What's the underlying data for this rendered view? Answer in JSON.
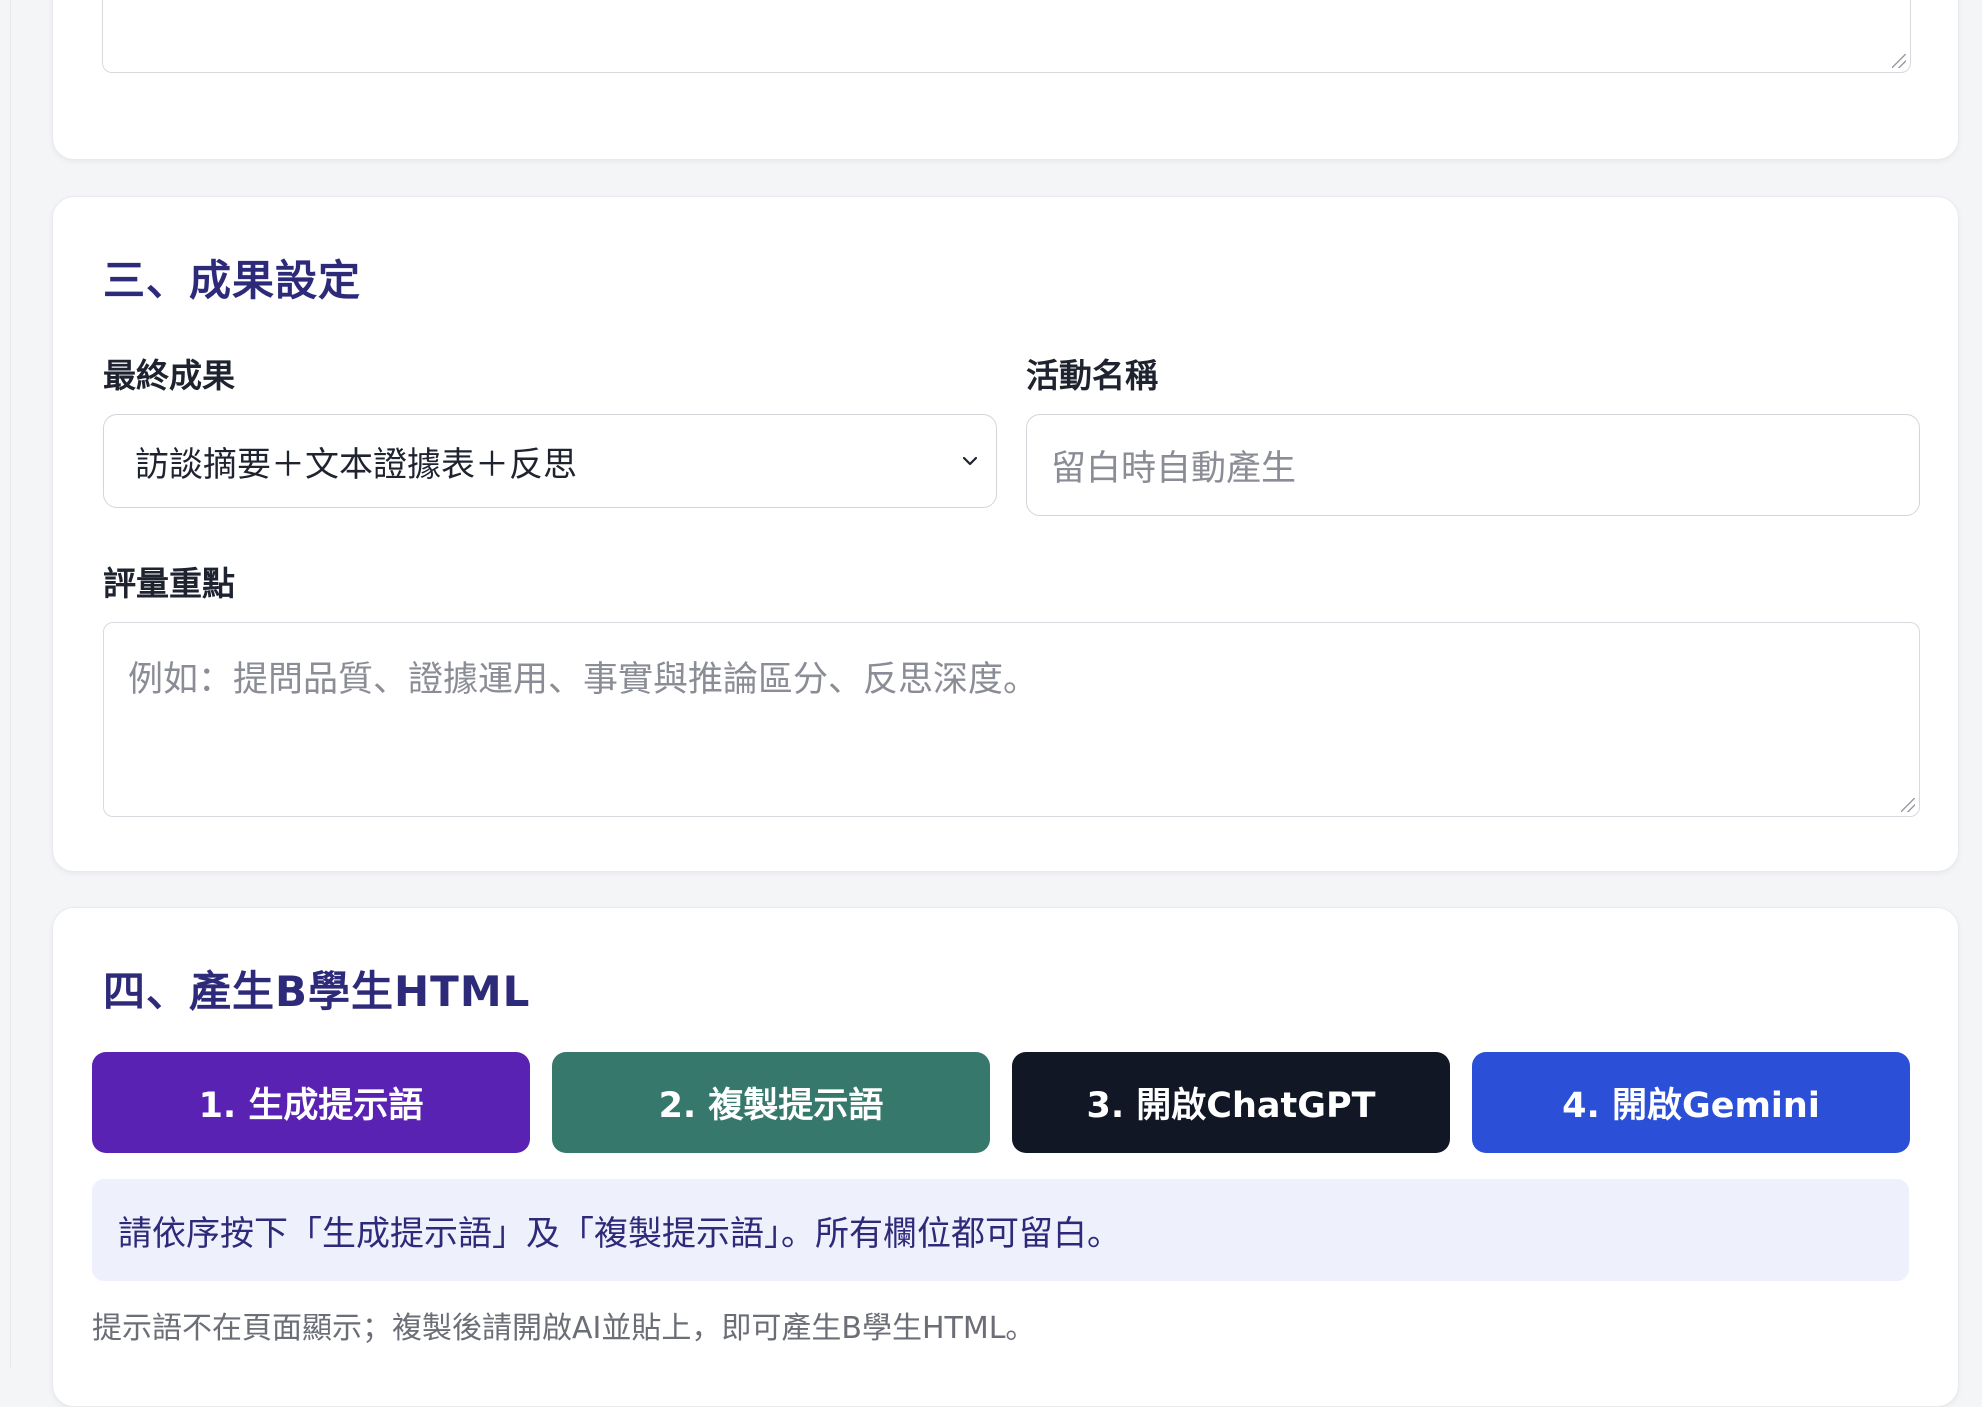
{
  "section3": {
    "title": "三、成果設定",
    "final_output_label": "最終成果",
    "final_output_value": "訪談摘要＋文本證據表＋反思",
    "activity_name_label": "活動名稱",
    "activity_name_placeholder": "留白時自動產生",
    "assessment_label": "評量重點",
    "assessment_placeholder": "例如：提問品質、證據運用、事實與推論區分、反思深度。"
  },
  "section4": {
    "title": "四、產生B學生HTML",
    "buttons": [
      {
        "label": "1. 生成提示語",
        "color": "#5a22b3"
      },
      {
        "label": "2. 複製提示語",
        "color": "#36786c"
      },
      {
        "label": "3. 開啟ChatGPT",
        "color": "#121726"
      },
      {
        "label": "4. 開啟Gemini",
        "color": "#2b4fd6"
      }
    ],
    "info": "請依序按下「生成提示語」及「複製提示語」。所有欄位都可留白。",
    "note": "提示語不在頁面顯示；複製後請開啟AI並貼上，即可產生B學生HTML。"
  },
  "icons": {
    "select_chevron": "chevron-down-icon",
    "resize_grip": "resize-grip-icon"
  },
  "colors": {
    "section_title": "#2e2a7a",
    "info_bg": "#eef0fc"
  }
}
